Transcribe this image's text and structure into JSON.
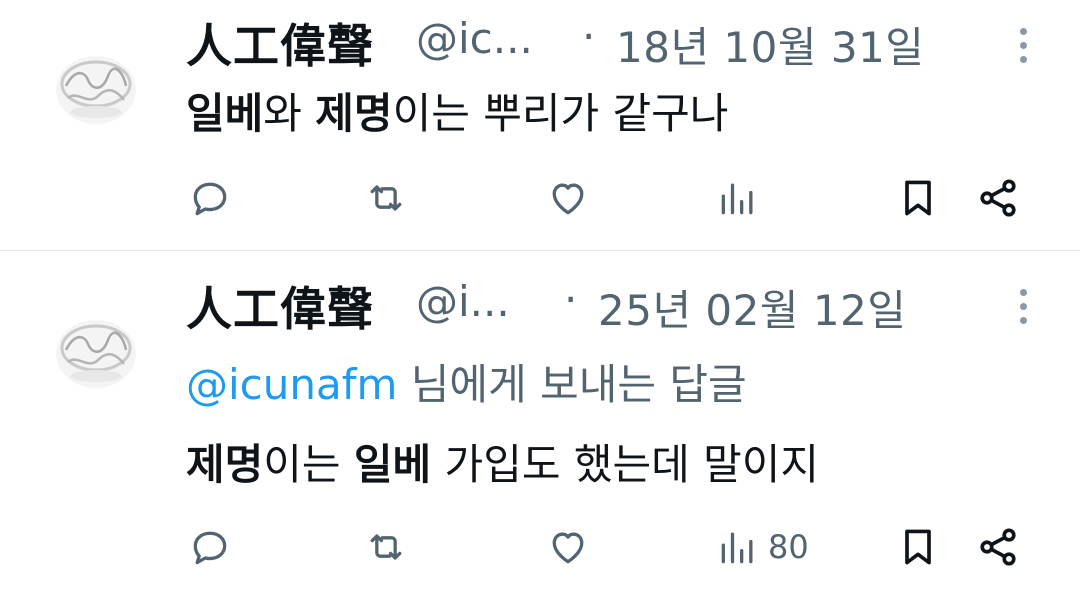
{
  "tweets": [
    {
      "display_name": "人工偉聲",
      "handle": "@ic...",
      "separator": "·",
      "date": "18년 10월 31일",
      "text_parts": [
        {
          "text": "일베",
          "bold": true
        },
        {
          "text": "와 ",
          "bold": false
        },
        {
          "text": "제명",
          "bold": true
        },
        {
          "text": "이는 뿌리가 같구나",
          "bold": false
        }
      ],
      "views": ""
    },
    {
      "display_name": "人工偉聲",
      "handle": "@i...",
      "separator": "·",
      "date": "25년 02월 12일",
      "reply_to": {
        "mention": "@icunafm",
        "suffix": " 님에게 보내는 답글"
      },
      "text_parts": [
        {
          "text": "제명",
          "bold": true
        },
        {
          "text": "이는 ",
          "bold": false
        },
        {
          "text": "일베",
          "bold": true
        },
        {
          "text": " 가입도 했는데 말이지",
          "bold": false
        }
      ],
      "views": "80"
    }
  ],
  "icons": {
    "reply": "comment-icon",
    "retweet": "retweet-icon",
    "like": "heart-icon",
    "views": "bar-chart-icon",
    "bookmark": "bookmark-icon",
    "share": "share-icon",
    "more": "more-vertical-icon"
  },
  "colors": {
    "text": "#0f1419",
    "secondary": "#536471",
    "link": "#1d9bf0",
    "divider": "#e6e9ec"
  }
}
